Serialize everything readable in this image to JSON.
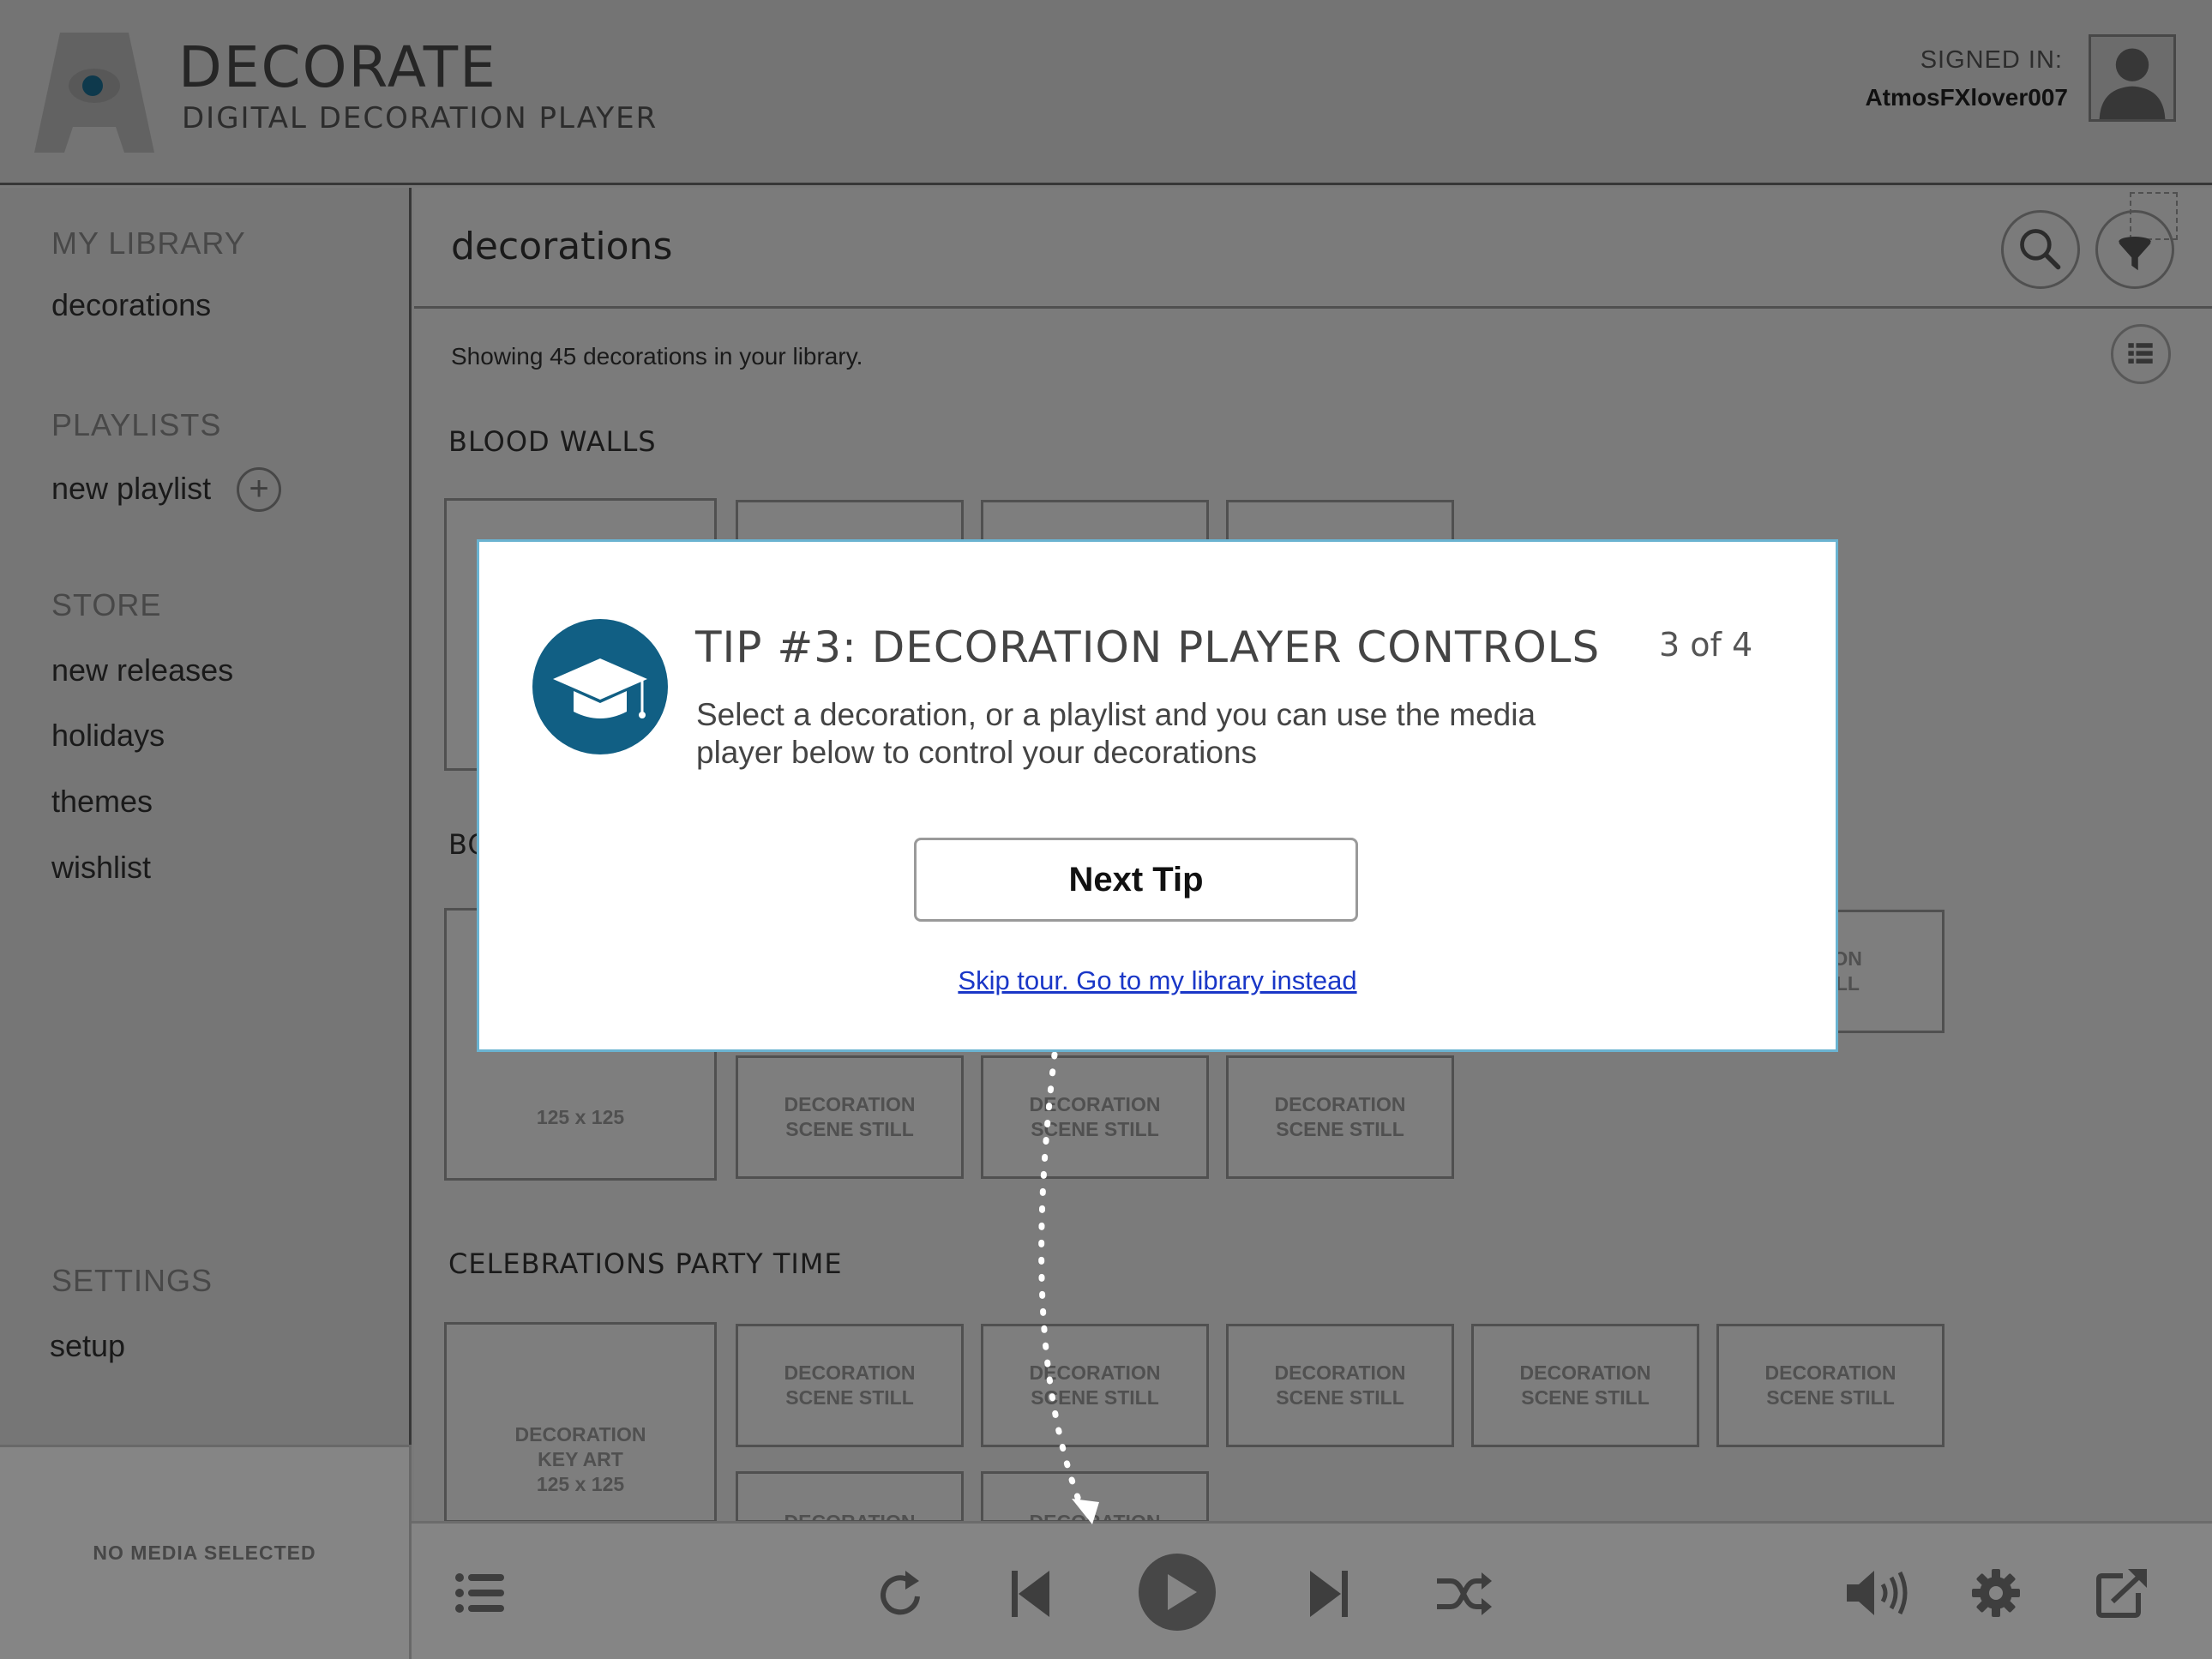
{
  "app": {
    "title": "DECORATE",
    "subtitle": "DIGITAL DECORATION PLAYER",
    "signed_in_label": "SIGNED IN:",
    "username": "AtmosFXlover007"
  },
  "sidebar": {
    "library_head": "MY LIBRARY",
    "library_items": [
      "decorations"
    ],
    "playlists_head": "PLAYLISTS",
    "new_playlist": "new playlist",
    "store_head": "STORE",
    "store_items": [
      "new releases",
      "holidays",
      "themes",
      "wishlist"
    ],
    "settings_head": "SETTINGS",
    "settings_items": [
      "setup"
    ]
  },
  "now_playing": {
    "text": "NO MEDIA SELECTED"
  },
  "main": {
    "title": "decorations",
    "showing": "Showing 45 decorations in your library.",
    "sections": [
      {
        "title": "BLOOD WALLS"
      },
      {
        "title": "BO"
      },
      {
        "title": "CELEBRATIONS PARTY TIME"
      }
    ],
    "tiles": {
      "key_art_line1": "DECORATION",
      "key_art_line2": "KEY ART",
      "key_art_size": "125 x 125",
      "still_line1": "DECORATION",
      "still_line2": "SCENE STILL",
      "partial_still_line1": "ATION",
      "partial_still_line2": "STILL"
    }
  },
  "modal": {
    "title": "TIP #3:  DECORATION PLAYER CONTROLS",
    "counter": "3 of 4",
    "body": "Select a decoration, or a playlist and you can use the media player below to control your decorations",
    "next_button": "Next Tip",
    "skip_link": "Skip tour. Go to my library instead"
  },
  "icons": {
    "search": "search-icon",
    "filter": "filter-icon",
    "view": "grid-view-icon",
    "playlist": "playlist-icon",
    "repeat": "repeat-icon",
    "previous": "skip-back-icon",
    "play": "play-icon",
    "next": "skip-forward-icon",
    "shuffle": "shuffle-icon",
    "volume": "volume-icon",
    "settings": "gear-icon",
    "external": "external-link-icon",
    "tip": "graduation-cap-icon"
  },
  "colors": {
    "accent": "#115f84",
    "modal_border": "#6ab3d1",
    "link": "#1a37c7"
  }
}
